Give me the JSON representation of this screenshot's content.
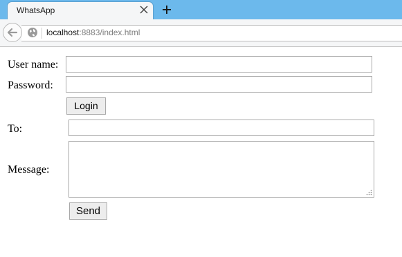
{
  "browser": {
    "tab_title": "WhatsApp",
    "url_host": "localhost",
    "url_rest": ":8883/index.html",
    "icons": {
      "tab_close": "close-icon",
      "new_tab": "plus-icon",
      "back": "back-arrow-icon",
      "site": "globe-icon"
    }
  },
  "login_form": {
    "username_label": "User name:",
    "username_value": "",
    "password_label": "Password:",
    "password_value": "",
    "login_button": "Login"
  },
  "message_form": {
    "to_label": "To:",
    "to_value": "",
    "message_label": "Message:",
    "message_value": "",
    "send_button": "Send"
  }
}
